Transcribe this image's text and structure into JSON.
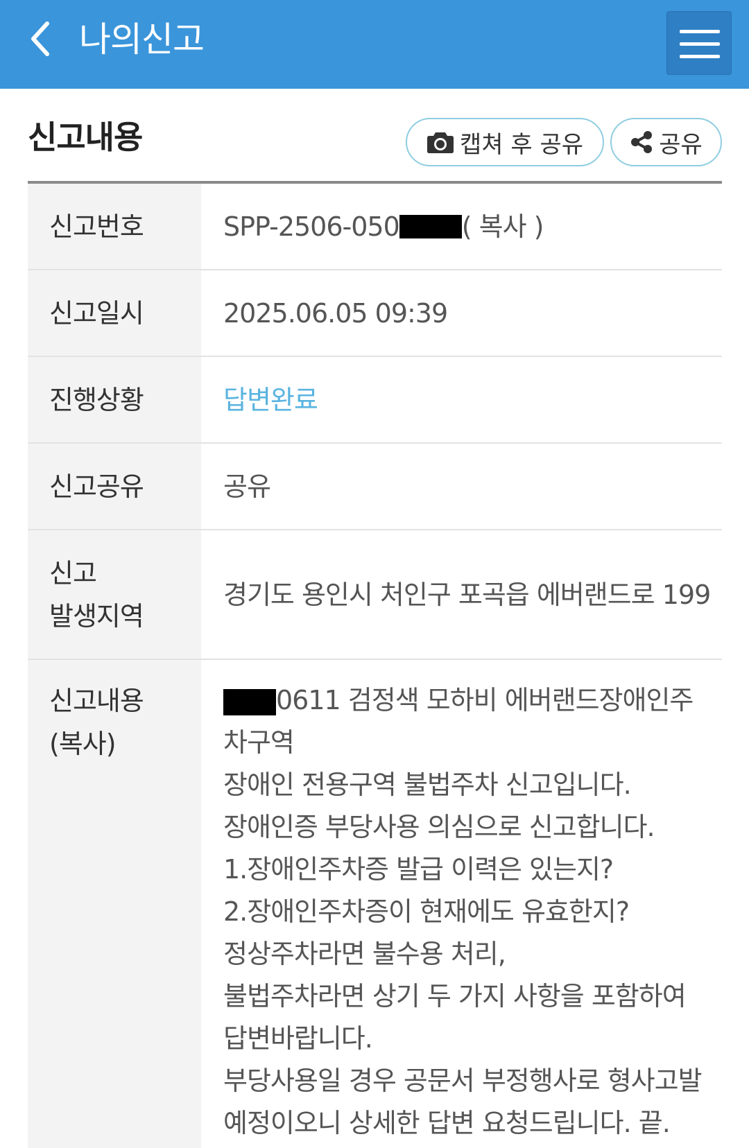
{
  "header": {
    "title": "나의신고"
  },
  "section": {
    "title": "신고내용",
    "capture_share_label": "캡쳐 후 공유",
    "share_label": "공유"
  },
  "report": {
    "number_label": "신고번호",
    "number_value": "SPP-2506-050",
    "copy_label": "( 복사 )",
    "datetime_label": "신고일시",
    "datetime_value": "2025.06.05 09:39",
    "status_label": "진행상황",
    "status_value": "답변완료",
    "status_color": "#5ab4e0",
    "sharing_label": "신고공유",
    "sharing_value": "공유",
    "location_label_1": "신고",
    "location_label_2": "발생지역",
    "location_value": "경기도 용인시 처인구 포곡읍 에버랜드로 199",
    "content_label_1": "신고내용",
    "content_label_2": "(복사)",
    "content_lines": [
      "0611 검정색 모하비 에버랜드장애인주",
      "차구역",
      "장애인 전용구역 불법주차 신고입니다.",
      "장애인증 부당사용 의심으로 신고합니다.",
      "1.장애인주차증 발급 이력은 있는지?",
      "2.장애인주차증이 현재에도 유효한지?",
      "정상주차라면 불수용 처리,",
      "불법주차라면 상기 두 가지 사항을 포함하여",
      "답변바랍니다.",
      "부당사용일 경우 공문서 부정행사로 형사고발",
      "예정이오니 상세한 답변 요청드립니다. 끝."
    ]
  },
  "colors": {
    "header_bg": "#3a95db",
    "pill_border": "#8fcde0"
  },
  "icons": {
    "back": "chevron-left-icon",
    "menu": "hamburger-menu-icon",
    "camera": "camera-icon",
    "share": "share-icon"
  }
}
